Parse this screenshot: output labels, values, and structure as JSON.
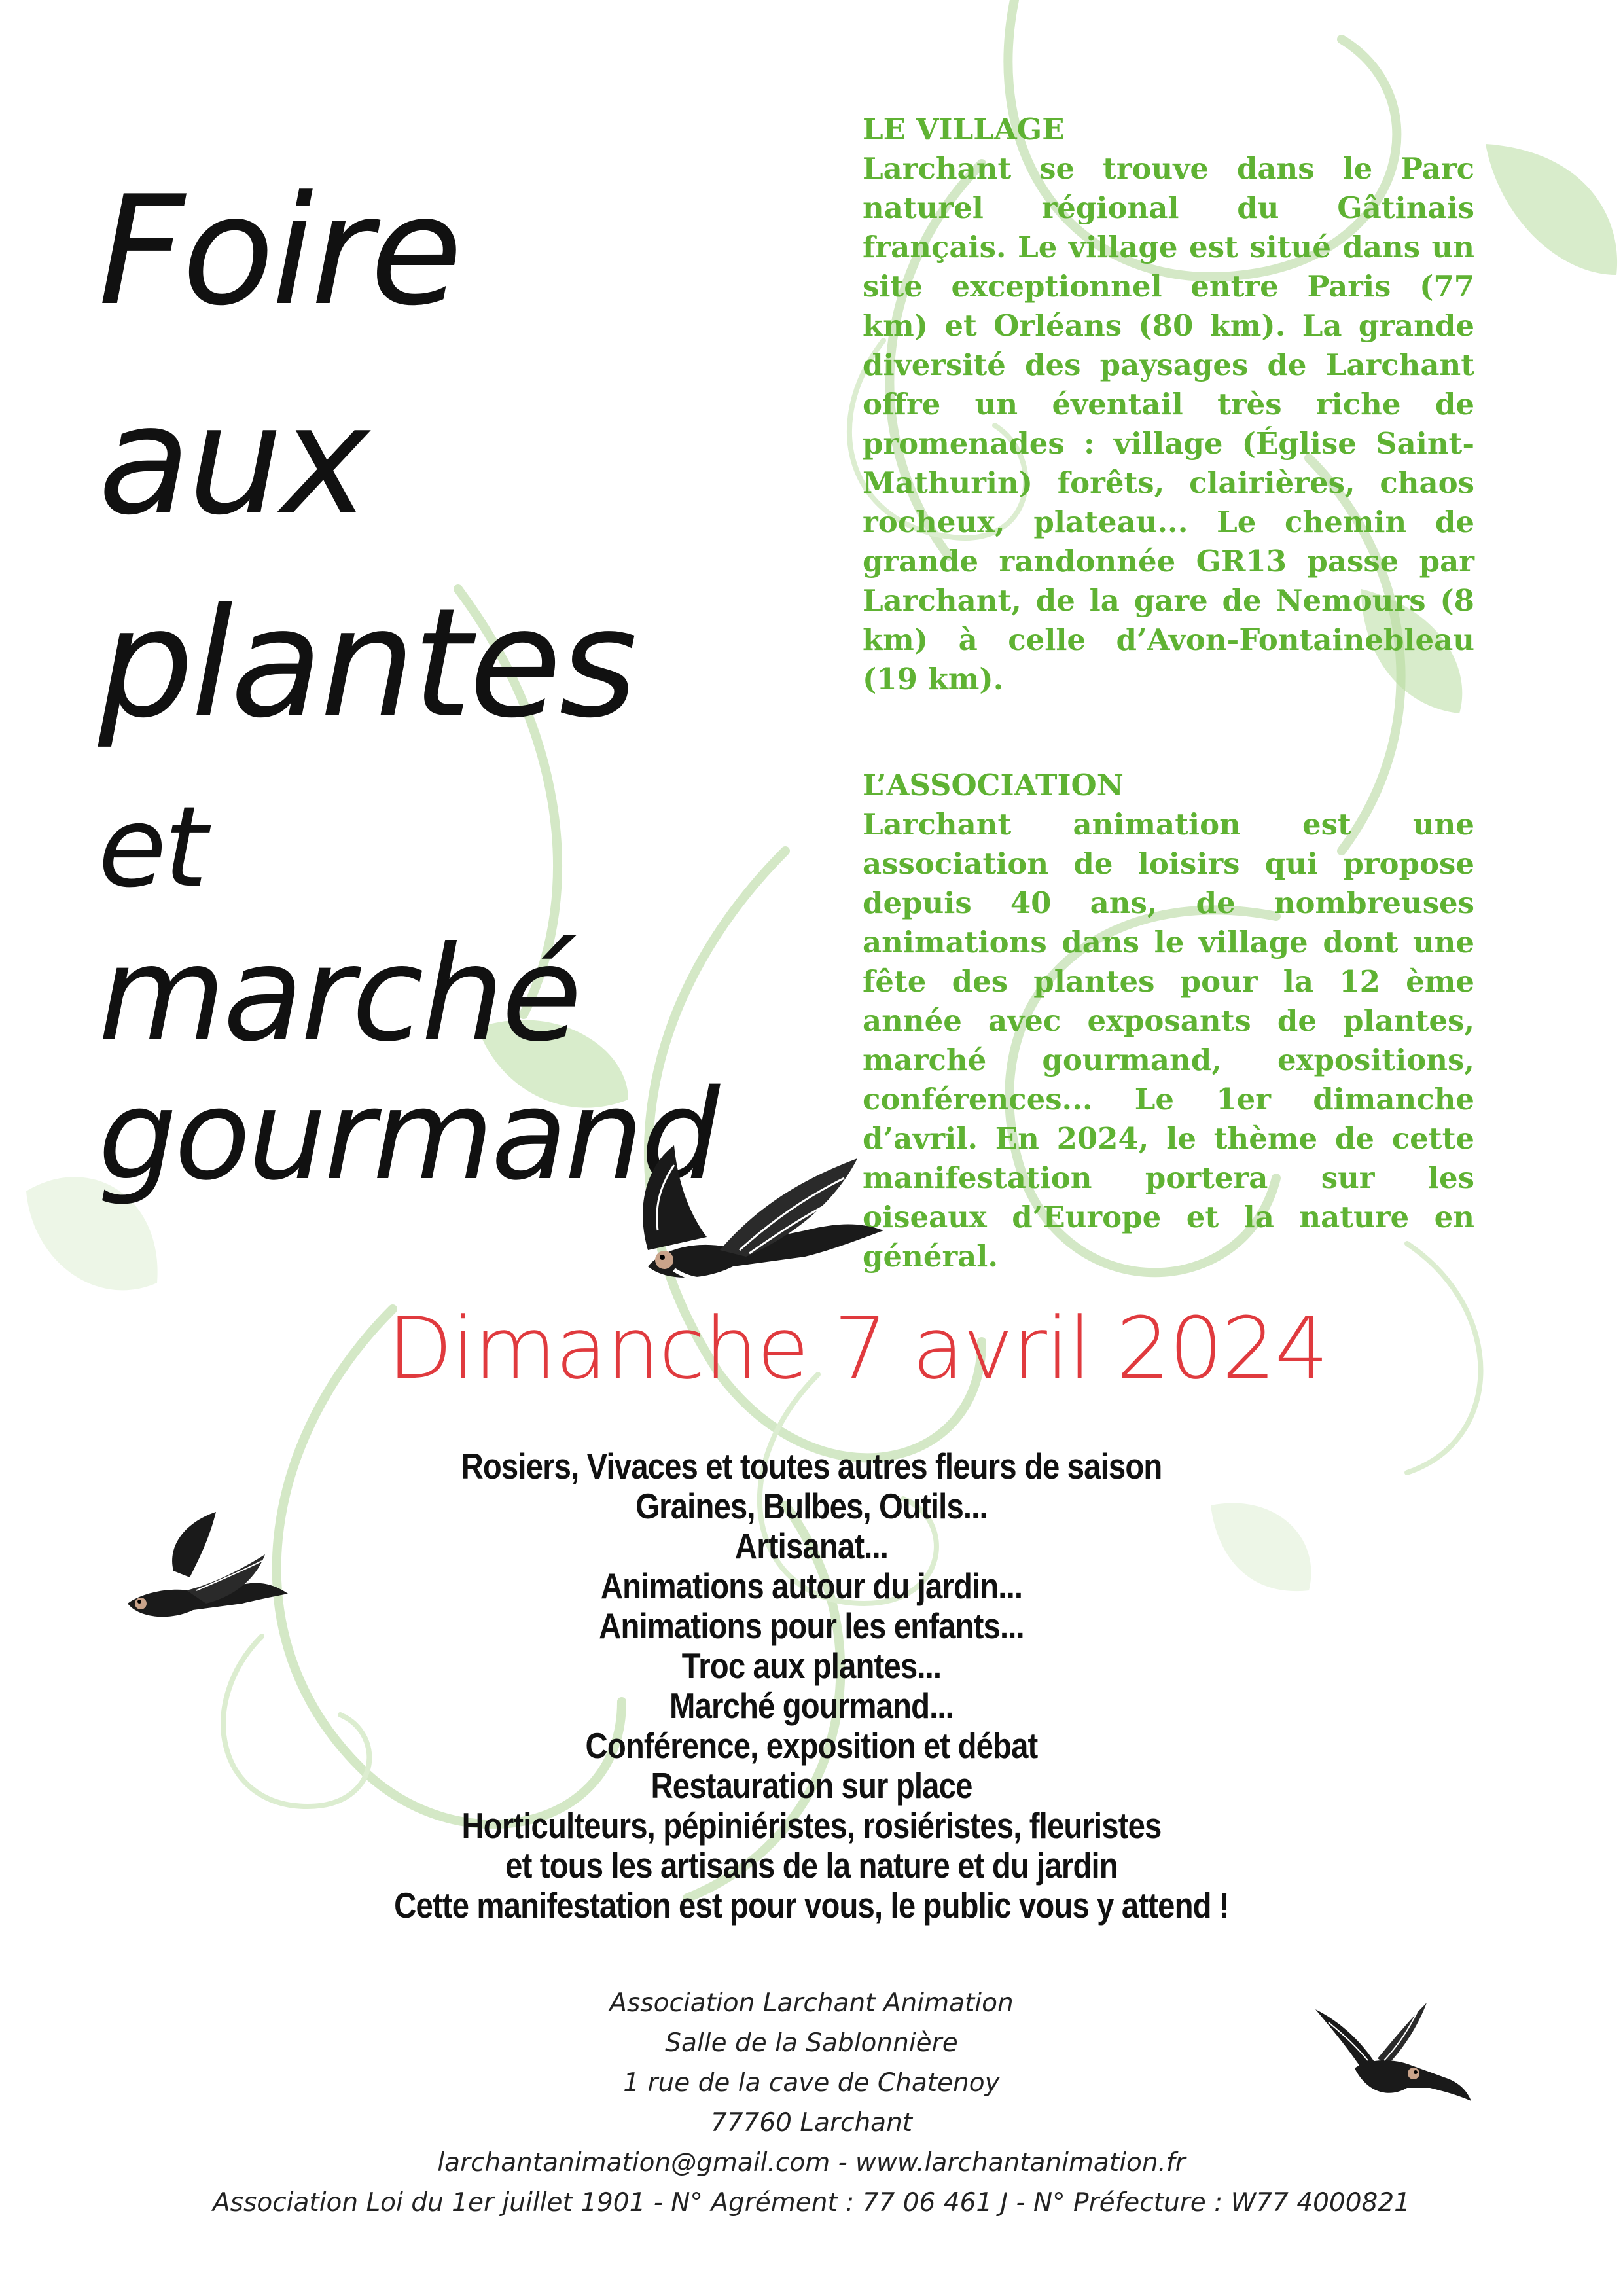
{
  "title": {
    "line1": "Foire",
    "line2": "aux",
    "line3": "plantes",
    "line4": "et",
    "line5": "marché",
    "line6": "gourmand"
  },
  "village": {
    "heading": "LE VILLAGE",
    "body": "Larchant se trouve dans le Parc naturel régional du Gâtinais français. Le village est situé dans un site exceptionnel entre Paris (77 km) et Orléans (80 km). La grande diversité des paysages de Larchant offre un éventail très riche de promenades : village (Église Saint-Mathurin) forêts, clairières, chaos rocheux, plateau... Le chemin de grande randonnée GR13 passe par Larchant, de la gare de Nemours (8 km) à celle d’Avon-Fontainebleau (19 km)."
  },
  "association": {
    "heading": "L’ASSOCIATION",
    "body": "Larchant animation est une association de loisirs qui propose depuis 40 ans, de nombreuses animations dans le village dont une fête des plantes pour la 12 ème année avec exposants de plantes, marché gourmand, expositions, conférences... Le 1er dimanche d’avril. En 2024, le thème de cette manifestation portera sur les oiseaux d’Europe et la nature en général."
  },
  "date": "Dimanche 7 avril 2024",
  "features": [
    "Rosiers, Vivaces et toutes autres fleurs de saison",
    "Graines, Bulbes, Outils...",
    "Artisanat...",
    "Animations autour du jardin...",
    "Animations pour les enfants...",
    "Troc aux plantes...",
    "Marché gourmand...",
    "Conférence, exposition et débat",
    "Restauration sur place",
    "Horticulteurs, pépiniéristes, rosiéristes, fleuristes",
    "et tous les artisans de la nature et du jardin",
    "Cette manifestation est pour vous, le public vous y attend !"
  ],
  "footer": {
    "org": "Association Larchant Animation",
    "venue": "Salle de la  Sablonnière",
    "street": "1 rue de la cave de Chatenoy",
    "city": "77760 Larchant",
    "contact": "larchantanimation@gmail.com - www.larchantanimation.fr",
    "legal": "Association Loi du 1er juillet 1901 - N° Agrément : 77 06 461 J - N° Préfecture : W77 4000821"
  },
  "colors": {
    "green_text": "#5fb233",
    "red_date": "#e03a3e",
    "swirl_green": "#a9d38f",
    "black_text": "#111111"
  },
  "decorations": [
    "swallow-bird-illustration",
    "green-floral-swirl-background"
  ]
}
